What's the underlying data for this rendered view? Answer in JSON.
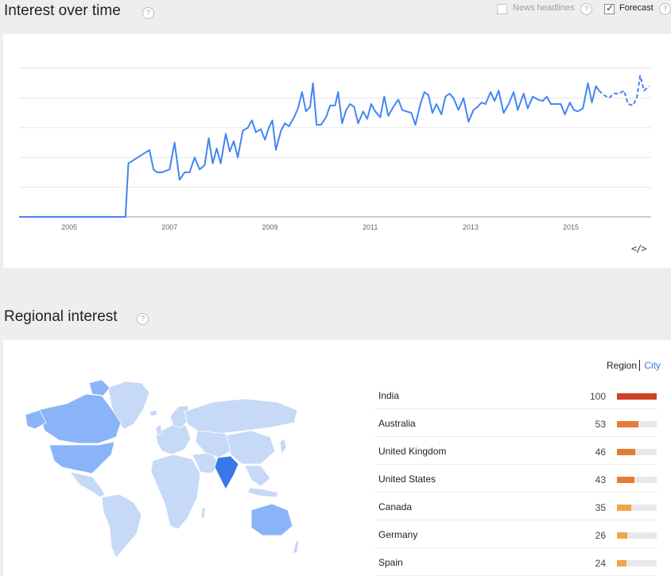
{
  "interest": {
    "title": "Interest over time",
    "help": "?",
    "news_headlines_label": "News headlines",
    "news_headlines_checked": false,
    "forecast_label": "Forecast",
    "forecast_checked": true,
    "embed_label": "</>"
  },
  "chart_data": {
    "type": "line",
    "title": "Interest over time",
    "xlabel": "",
    "ylabel": "",
    "xlim": [
      2004.0,
      2016.6
    ],
    "ylim": [
      0,
      100
    ],
    "x_ticks": [
      2005,
      2007,
      2009,
      2011,
      2013,
      2015
    ],
    "y_gridlines": [
      20,
      40,
      60,
      80,
      100
    ],
    "grid": true,
    "series": [
      {
        "style": "solid",
        "color": "#4285f4",
        "points": [
          [
            2004.0,
            0
          ],
          [
            2006.12,
            0
          ],
          [
            2006.18,
            36
          ],
          [
            2006.6,
            45
          ],
          [
            2006.68,
            32
          ],
          [
            2006.75,
            30
          ],
          [
            2006.85,
            30
          ],
          [
            2007.0,
            32
          ],
          [
            2007.1,
            50
          ],
          [
            2007.2,
            25
          ],
          [
            2007.3,
            30
          ],
          [
            2007.4,
            30
          ],
          [
            2007.5,
            40
          ],
          [
            2007.6,
            32
          ],
          [
            2007.7,
            35
          ],
          [
            2007.78,
            53
          ],
          [
            2007.86,
            36
          ],
          [
            2007.94,
            46
          ],
          [
            2008.02,
            36
          ],
          [
            2008.12,
            56
          ],
          [
            2008.2,
            44
          ],
          [
            2008.28,
            51
          ],
          [
            2008.36,
            40
          ],
          [
            2008.46,
            58
          ],
          [
            2008.56,
            60
          ],
          [
            2008.64,
            65
          ],
          [
            2008.72,
            57
          ],
          [
            2008.82,
            59
          ],
          [
            2008.9,
            52
          ],
          [
            2008.98,
            60
          ],
          [
            2009.05,
            65
          ],
          [
            2009.12,
            45
          ],
          [
            2009.22,
            58
          ],
          [
            2009.3,
            63
          ],
          [
            2009.38,
            61
          ],
          [
            2009.48,
            67
          ],
          [
            2009.56,
            73
          ],
          [
            2009.64,
            84
          ],
          [
            2009.72,
            71
          ],
          [
            2009.8,
            74
          ],
          [
            2009.86,
            90
          ],
          [
            2009.93,
            62
          ],
          [
            2010.02,
            62
          ],
          [
            2010.12,
            67
          ],
          [
            2010.2,
            75
          ],
          [
            2010.3,
            75
          ],
          [
            2010.36,
            84
          ],
          [
            2010.44,
            63
          ],
          [
            2010.52,
            72
          ],
          [
            2010.6,
            76
          ],
          [
            2010.68,
            74
          ],
          [
            2010.76,
            63
          ],
          [
            2010.86,
            71
          ],
          [
            2010.94,
            66
          ],
          [
            2011.02,
            76
          ],
          [
            2011.1,
            71
          ],
          [
            2011.2,
            67
          ],
          [
            2011.28,
            81
          ],
          [
            2011.36,
            68
          ],
          [
            2011.46,
            74
          ],
          [
            2011.56,
            79
          ],
          [
            2011.64,
            72
          ],
          [
            2011.72,
            71
          ],
          [
            2011.82,
            70
          ],
          [
            2011.9,
            62
          ],
          [
            2012.0,
            76
          ],
          [
            2012.08,
            84
          ],
          [
            2012.16,
            82
          ],
          [
            2012.24,
            70
          ],
          [
            2012.32,
            76
          ],
          [
            2012.42,
            69
          ],
          [
            2012.5,
            81
          ],
          [
            2012.58,
            83
          ],
          [
            2012.66,
            80
          ],
          [
            2012.76,
            72
          ],
          [
            2012.86,
            80
          ],
          [
            2012.96,
            64
          ],
          [
            2013.06,
            72
          ],
          [
            2013.14,
            74
          ],
          [
            2013.22,
            77
          ],
          [
            2013.3,
            76
          ],
          [
            2013.4,
            84
          ],
          [
            2013.48,
            78
          ],
          [
            2013.56,
            85
          ],
          [
            2013.66,
            70
          ],
          [
            2013.76,
            76
          ],
          [
            2013.86,
            84
          ],
          [
            2013.94,
            72
          ],
          [
            2014.06,
            83
          ],
          [
            2014.14,
            73
          ],
          [
            2014.24,
            81
          ],
          [
            2014.34,
            79
          ],
          [
            2014.44,
            78
          ],
          [
            2014.52,
            81
          ],
          [
            2014.6,
            76
          ],
          [
            2014.7,
            76
          ],
          [
            2014.8,
            76
          ],
          [
            2014.88,
            69
          ],
          [
            2014.98,
            77
          ],
          [
            2015.06,
            72
          ],
          [
            2015.14,
            71
          ],
          [
            2015.24,
            73
          ],
          [
            2015.34,
            90
          ],
          [
            2015.42,
            77
          ],
          [
            2015.5,
            88
          ],
          [
            2015.56,
            85
          ]
        ]
      },
      {
        "style": "dashed",
        "color": "#4285f4",
        "points": [
          [
            2015.56,
            85
          ],
          [
            2015.66,
            82
          ],
          [
            2015.76,
            80
          ],
          [
            2015.86,
            83
          ],
          [
            2015.96,
            83
          ],
          [
            2016.06,
            85
          ],
          [
            2016.14,
            76
          ],
          [
            2016.24,
            75
          ],
          [
            2016.32,
            81
          ],
          [
            2016.38,
            95
          ],
          [
            2016.46,
            85
          ],
          [
            2016.56,
            88
          ]
        ]
      }
    ]
  },
  "regional": {
    "title": "Regional interest",
    "help": "?",
    "toggle_region": "Region",
    "toggle_city": "City",
    "map_highlight_color": "#4285f4",
    "bar_colors": [
      "#cc4125",
      "#e67c34",
      "#e67c34",
      "#e67c34",
      "#f1a54a",
      "#f1a54a",
      "#f1a54a"
    ],
    "rows": [
      {
        "name": "India",
        "value": 100
      },
      {
        "name": "Australia",
        "value": 53
      },
      {
        "name": "United Kingdom",
        "value": 46
      },
      {
        "name": "United States",
        "value": 43
      },
      {
        "name": "Canada",
        "value": 35
      },
      {
        "name": "Germany",
        "value": 26
      },
      {
        "name": "Spain",
        "value": 24
      }
    ]
  }
}
